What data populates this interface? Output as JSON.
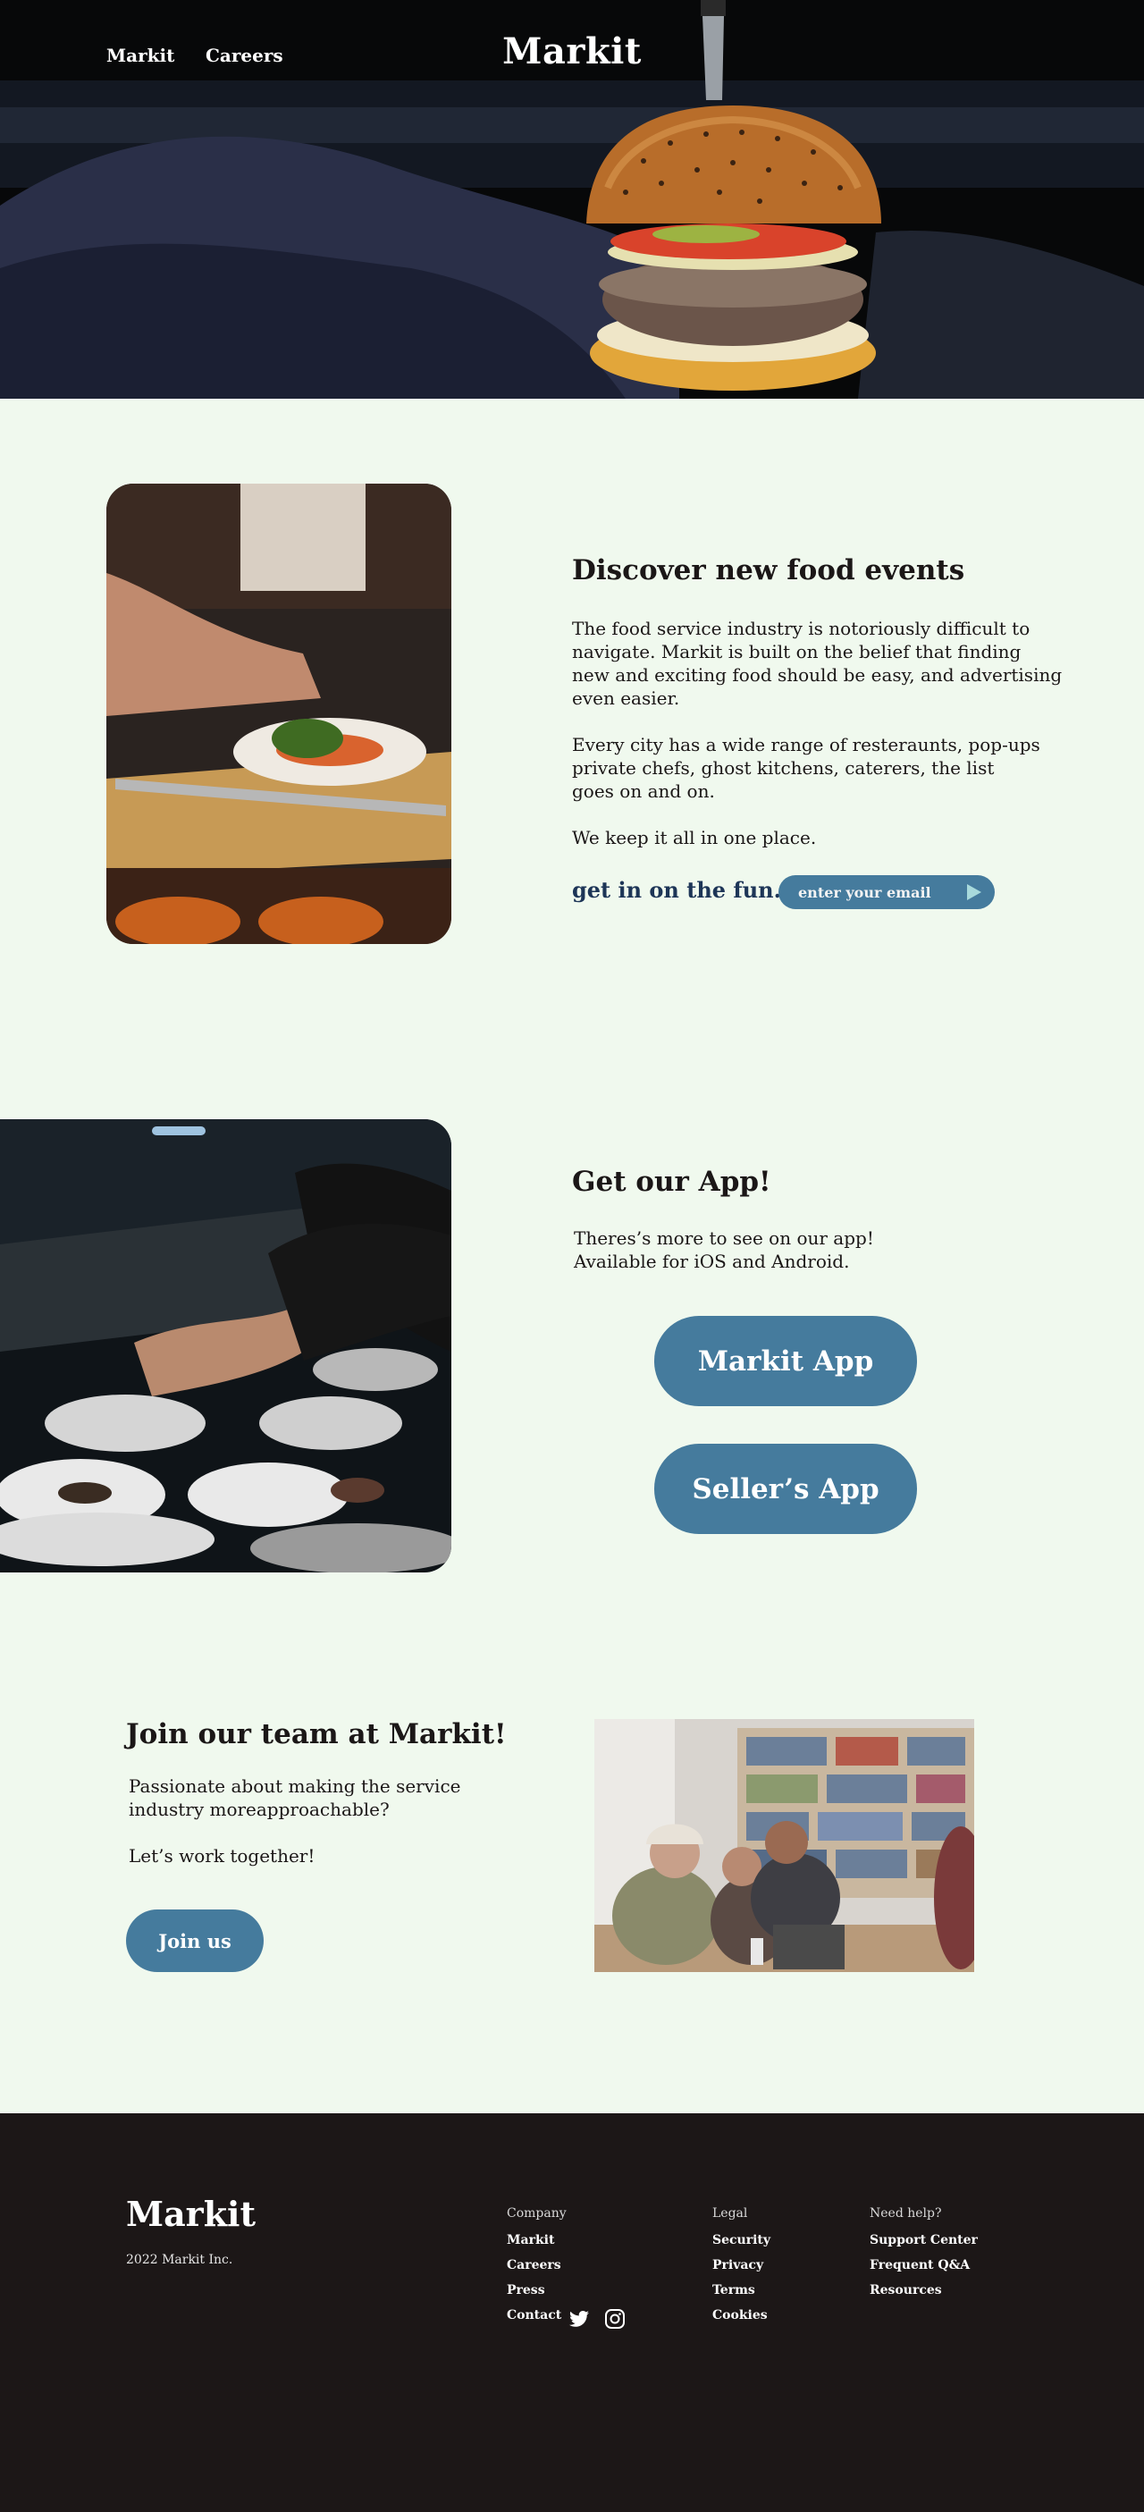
{
  "nav": {
    "left_links": [
      "Markit",
      "Careers"
    ],
    "brand": "Markit"
  },
  "discover": {
    "title": "Discover new food events",
    "para1_lines": [
      "The food service industry is notoriously difficult to",
      "navigate. Markit is built on the belief that finding",
      "new and exciting food should be easy, and advertising",
      "even easier."
    ],
    "para2_lines": [
      "Every city has a wide range of resteraunts, pop-ups",
      "private chefs, ghost kitchens, caterers, the list",
      "goes on and on."
    ],
    "para3": "We keep it all in one place.",
    "cta_label": "get in on the fun.",
    "email_placeholder": "enter your email",
    "submit_icon": "play-arrow-icon"
  },
  "app": {
    "title": "Get our App!",
    "lines": [
      "Theres’s more to see on our app!",
      "Available for iOS and Android."
    ],
    "buttons": [
      "Markit App",
      "Seller’s App"
    ]
  },
  "join": {
    "title": "Join our team at Markit!",
    "lines": [
      "Passionate about making the service",
      "industry moreapproachable?"
    ],
    "line3": "Let’s work together!",
    "button": "Join us"
  },
  "footer": {
    "brand": "Markit",
    "copyright": "2022 Markit Inc.",
    "columns": [
      {
        "heading": "Company",
        "links": [
          "Markit",
          "Careers",
          "Press",
          "Contact"
        ]
      },
      {
        "heading": "Legal",
        "links": [
          "Security",
          "Privacy",
          "Terms",
          "Cookies"
        ]
      },
      {
        "heading": "Need help?",
        "links": [
          "Support Center",
          "Frequent Q&A",
          "Resources"
        ]
      }
    ],
    "social_icons": [
      "twitter-icon",
      "instagram-icon"
    ]
  },
  "colors": {
    "page_bg": "#f0f9ee",
    "accent": "#457b9d",
    "cta_text": "#1d3557",
    "footer_bg": "#1c1717"
  }
}
